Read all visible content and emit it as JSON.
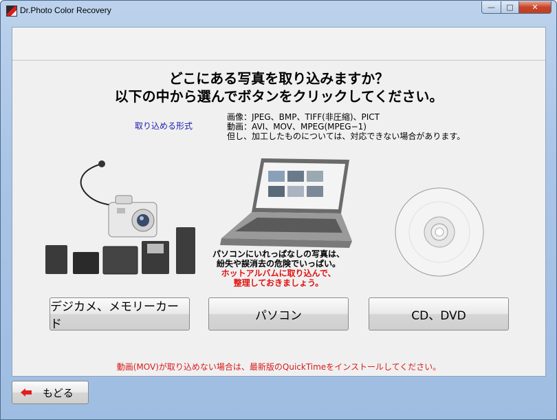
{
  "window": {
    "title": "Dr.Photo Color Recovery",
    "min_glyph": "—",
    "max_glyph": "□",
    "close_glyph": "✕"
  },
  "heading": {
    "line1": "どこにある写真を取り込みますか？",
    "line2": "以下の中から選んでボタンをクリックしてください。"
  },
  "formats": {
    "label": "取り込める形式",
    "image": "画像：JPEG、BMP、TIFF(非圧縮)、PICT",
    "video": "動画：AVI、MOV、MPEG(MPEG−1)",
    "note": "但し、加工したものについては、対応できない場合があります。"
  },
  "pc_message": {
    "line1": "パソコンにいれっぱなしの写真は、",
    "line2": "紛失や誤消去の危険でいっぱい。",
    "line3": "ホットアルバムに取り込んで、",
    "line4": "整理しておきましょう。"
  },
  "buttons": {
    "camera": "デジカメ、メモリーカード",
    "pc": "パソコン",
    "cd": "CD、DVD",
    "back": "もどる"
  },
  "notice": "動画(MOV)が取り込めない場合は、最新版のQuickTimeをインストールしてください。",
  "icons": [
    "camera-icon",
    "memory-card-icon",
    "laptop-icon",
    "cd-disc-icon",
    "back-arrow-icon"
  ],
  "colors": {
    "alert_red": "#e01010",
    "link_blue": "#1a1ab4",
    "titlebar": "#bcd2ec"
  }
}
